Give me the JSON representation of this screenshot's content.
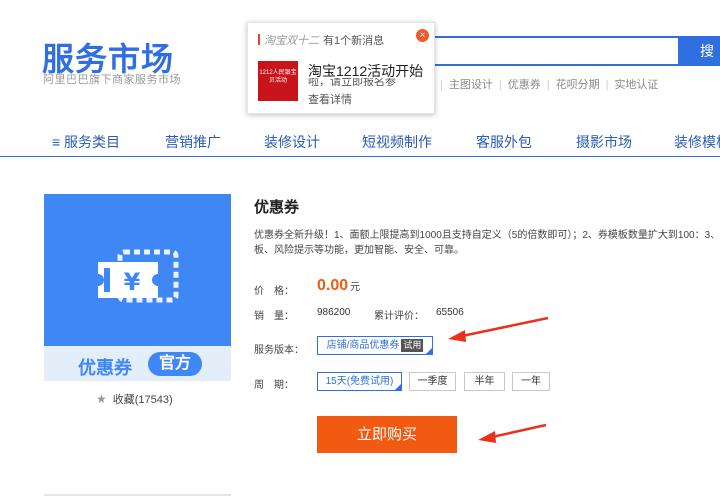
{
  "header": {
    "logo_title": "服务市场",
    "logo_subtitle": "阿里巴巴旗下商家服务市场",
    "search_button": "搜",
    "hot_links": [
      "主图设计",
      "优惠券",
      "花呗分期",
      "实地认证"
    ]
  },
  "popup": {
    "source": "淘宝双十二",
    "message_count_text": "有1个新消息",
    "thumb_text": "1212人民银宝贝活动",
    "title": "淘宝1212活动开始",
    "snippet": "啦，请立即报名参",
    "view_link": "查看详情",
    "close_label": "×"
  },
  "nav": {
    "items": [
      "≡ 服务类目",
      "营销推广",
      "装修设计",
      "短视频制作",
      "客服外包",
      "摄影市场",
      "装修模板"
    ]
  },
  "product": {
    "image_name": "优惠券",
    "image_tag": "官方",
    "favorites": "收藏(17543)",
    "title": "优惠券",
    "description_line1": "优惠券全新升级！1、面额上限提高到1000且支持自定义（5的倍数即可）；2、券模板数量扩大到100：3、",
    "description_line2": "板、风险提示等功能，更加智能、安全、可靠。",
    "price_label": "价　格：",
    "price_value": "0.00",
    "price_unit": "元",
    "sales_label": "销　量：",
    "sales_value": "986200",
    "rating_label": "累计评价：",
    "rating_value": "65506",
    "version_label": "服务版本：",
    "version_option": "店铺/商品优惠券",
    "version_trial_badge": "试用",
    "period_label": "周　期：",
    "period_options": [
      "15天(免费试用)",
      "一季度",
      "半年",
      "一年"
    ],
    "buy_button": "立即购买"
  },
  "colors": {
    "brand_blue": "#2f6fe0",
    "accent_orange": "#f25a12",
    "annotation_red": "#e8321e"
  }
}
